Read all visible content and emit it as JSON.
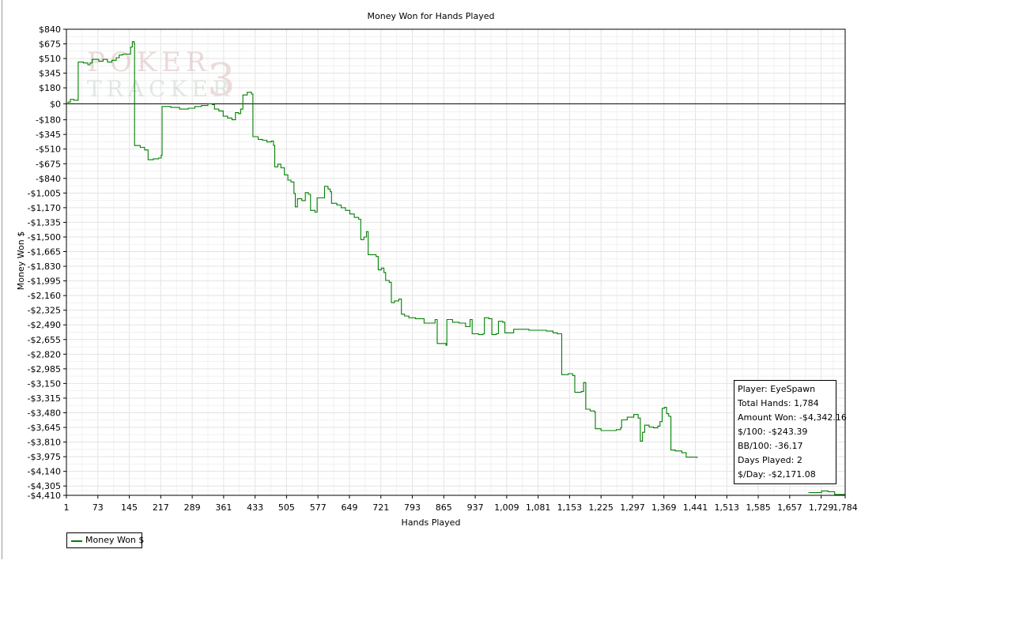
{
  "chart_data": {
    "type": "line",
    "title": "Money Won for Hands Played",
    "xlabel": "Hands Played",
    "ylabel": "Money Won $",
    "xlim": [
      1,
      1784
    ],
    "ylim": [
      -4410,
      840
    ],
    "x_ticks": [
      1,
      73,
      145,
      217,
      289,
      361,
      433,
      505,
      577,
      649,
      721,
      793,
      865,
      937,
      1009,
      1081,
      1153,
      1225,
      1297,
      1369,
      1441,
      1513,
      1585,
      1657,
      1729,
      1784
    ],
    "x_tick_labels": [
      "1",
      "73",
      "145",
      "217",
      "289",
      "361",
      "433",
      "505",
      "577",
      "649",
      "721",
      "793",
      "865",
      "937",
      "1,009",
      "1,081",
      "1,153",
      "1,225",
      "1,297",
      "1,369",
      "1,441",
      "1,513",
      "1,585",
      "1,657",
      "1,729",
      "1,784"
    ],
    "y_ticks": [
      840,
      675,
      510,
      345,
      180,
      0,
      -180,
      -345,
      -510,
      -675,
      -840,
      -1005,
      -1170,
      -1335,
      -1500,
      -1665,
      -1830,
      -1995,
      -2160,
      -2325,
      -2490,
      -2655,
      -2820,
      -2985,
      -3150,
      -3315,
      -3480,
      -3645,
      -3810,
      -3975,
      -4140,
      -4305,
      -4410
    ],
    "y_tick_labels": [
      "$840",
      "$675",
      "$510",
      "$345",
      "$180",
      "$0",
      "-$180",
      "-$345",
      "-$510",
      "-$675",
      "-$840",
      "-$1,005",
      "-$1,170",
      "-$1,335",
      "-$1,500",
      "-$1,665",
      "-$1,830",
      "-$1,995",
      "-$2,160",
      "-$2,325",
      "-$2,490",
      "-$2,655",
      "-$2,820",
      "-$2,985",
      "-$3,150",
      "-$3,315",
      "-$3,480",
      "-$3,645",
      "-$3,810",
      "-$3,975",
      "-$4,140",
      "-$4,305",
      "-$4,410"
    ],
    "grid": true,
    "legend_position": "bottom-left",
    "series": [
      {
        "name": "Money Won $",
        "color": "#008000",
        "points": [
          [
            1,
            0
          ],
          [
            5,
            20
          ],
          [
            10,
            50
          ],
          [
            18,
            40
          ],
          [
            26,
            40
          ],
          [
            28,
            470
          ],
          [
            40,
            460
          ],
          [
            50,
            440
          ],
          [
            55,
            460
          ],
          [
            60,
            500
          ],
          [
            75,
            480
          ],
          [
            85,
            500
          ],
          [
            95,
            470
          ],
          [
            105,
            490
          ],
          [
            115,
            520
          ],
          [
            122,
            550
          ],
          [
            130,
            560
          ],
          [
            138,
            560
          ],
          [
            145,
            560
          ],
          [
            148,
            640
          ],
          [
            152,
            700
          ],
          [
            156,
            680
          ],
          [
            157,
            -470
          ],
          [
            170,
            -490
          ],
          [
            180,
            -520
          ],
          [
            188,
            -630
          ],
          [
            200,
            -620
          ],
          [
            212,
            -610
          ],
          [
            218,
            -580
          ],
          [
            220,
            -30
          ],
          [
            240,
            -40
          ],
          [
            260,
            -60
          ],
          [
            280,
            -50
          ],
          [
            295,
            -30
          ],
          [
            310,
            -20
          ],
          [
            325,
            0
          ],
          [
            335,
            -10
          ],
          [
            340,
            -60
          ],
          [
            350,
            -80
          ],
          [
            360,
            -140
          ],
          [
            370,
            -160
          ],
          [
            380,
            -180
          ],
          [
            388,
            -100
          ],
          [
            395,
            -110
          ],
          [
            400,
            -60
          ],
          [
            405,
            100
          ],
          [
            415,
            130
          ],
          [
            425,
            110
          ],
          [
            428,
            -370
          ],
          [
            440,
            -400
          ],
          [
            450,
            -410
          ],
          [
            460,
            -430
          ],
          [
            470,
            -420
          ],
          [
            475,
            -470
          ],
          [
            478,
            -710
          ],
          [
            485,
            -680
          ],
          [
            492,
            -720
          ],
          [
            500,
            -800
          ],
          [
            508,
            -860
          ],
          [
            515,
            -880
          ],
          [
            522,
            -1010
          ],
          [
            525,
            -1160
          ],
          [
            530,
            -1070
          ],
          [
            540,
            -1090
          ],
          [
            548,
            -1000
          ],
          [
            555,
            -1020
          ],
          [
            560,
            -1200
          ],
          [
            570,
            -1220
          ],
          [
            575,
            -1060
          ],
          [
            585,
            -1060
          ],
          [
            592,
            -930
          ],
          [
            600,
            -960
          ],
          [
            605,
            -990
          ],
          [
            608,
            -1120
          ],
          [
            620,
            -1140
          ],
          [
            630,
            -1170
          ],
          [
            640,
            -1200
          ],
          [
            650,
            -1240
          ],
          [
            660,
            -1280
          ],
          [
            670,
            -1300
          ],
          [
            675,
            -1530
          ],
          [
            682,
            -1500
          ],
          [
            688,
            -1440
          ],
          [
            692,
            -1700
          ],
          [
            700,
            -1700
          ],
          [
            710,
            -1720
          ],
          [
            715,
            -1870
          ],
          [
            722,
            -1850
          ],
          [
            728,
            -1900
          ],
          [
            732,
            -1990
          ],
          [
            740,
            -2010
          ],
          [
            745,
            -2240
          ],
          [
            752,
            -2220
          ],
          [
            762,
            -2200
          ],
          [
            768,
            -2370
          ],
          [
            775,
            -2390
          ],
          [
            785,
            -2410
          ],
          [
            800,
            -2420
          ],
          [
            820,
            -2470
          ],
          [
            835,
            -2470
          ],
          [
            845,
            -2430
          ],
          [
            850,
            -2700
          ],
          [
            860,
            -2700
          ],
          [
            870,
            -2720
          ],
          [
            872,
            -2430
          ],
          [
            885,
            -2460
          ],
          [
            900,
            -2470
          ],
          [
            915,
            -2510
          ],
          [
            925,
            -2430
          ],
          [
            930,
            -2590
          ],
          [
            945,
            -2600
          ],
          [
            955,
            -2590
          ],
          [
            958,
            -2410
          ],
          [
            968,
            -2420
          ],
          [
            975,
            -2600
          ],
          [
            985,
            -2590
          ],
          [
            990,
            -2450
          ],
          [
            1000,
            -2460
          ],
          [
            1005,
            -2580
          ],
          [
            1025,
            -2540
          ],
          [
            1040,
            -2540
          ],
          [
            1060,
            -2550
          ],
          [
            1080,
            -2550
          ],
          [
            1100,
            -2560
          ],
          [
            1115,
            -2580
          ],
          [
            1125,
            -2590
          ],
          [
            1135,
            -3050
          ],
          [
            1150,
            -3040
          ],
          [
            1160,
            -3060
          ],
          [
            1165,
            -3250
          ],
          [
            1180,
            -3240
          ],
          [
            1185,
            -3140
          ],
          [
            1190,
            -3440
          ],
          [
            1200,
            -3460
          ],
          [
            1210,
            -3470
          ],
          [
            1212,
            -3660
          ],
          [
            1225,
            -3680
          ],
          [
            1240,
            -3680
          ],
          [
            1260,
            -3670
          ],
          [
            1270,
            -3650
          ],
          [
            1272,
            -3560
          ],
          [
            1285,
            -3530
          ],
          [
            1300,
            -3500
          ],
          [
            1310,
            -3540
          ],
          [
            1315,
            -3800
          ],
          [
            1320,
            -3700
          ],
          [
            1325,
            -3620
          ],
          [
            1335,
            -3640
          ],
          [
            1345,
            -3650
          ],
          [
            1355,
            -3630
          ],
          [
            1360,
            -3580
          ],
          [
            1365,
            -3430
          ],
          [
            1370,
            -3420
          ],
          [
            1375,
            -3490
          ],
          [
            1380,
            -3520
          ],
          [
            1385,
            -3900
          ],
          [
            1395,
            -3910
          ],
          [
            1410,
            -3930
          ],
          [
            1420,
            -3980
          ],
          [
            1445,
            -3990
          ]
        ]
      }
    ]
  },
  "info_box": {
    "player": "Player: EyeSpawn",
    "total_hands": "Total Hands: 1,784",
    "amount_won": "Amount Won: -$4,342.16",
    "per_100": "$/100: -$243.39",
    "bb_per_100": "BB/100: -36.17",
    "days_played": "Days Played: 2",
    "per_day": "$/Day: -$2,171.08"
  },
  "watermark": {
    "line1": "POKER",
    "line2": "TRACKER",
    "digit": "3",
    "color": "#d9b6b6"
  },
  "tail_points": [
    [
      1700,
      -4380
    ],
    [
      1730,
      -4360
    ],
    [
      1745,
      -4370
    ],
    [
      1760,
      -4400
    ],
    [
      1784,
      -4400
    ]
  ]
}
